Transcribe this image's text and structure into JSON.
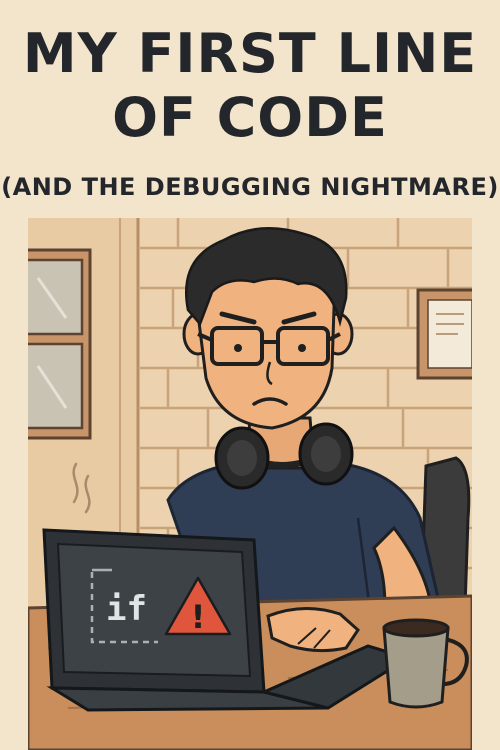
{
  "header": {
    "title_line1": "MY FIRST LINE",
    "title_line2": "OF CODE",
    "subtitle": "(AND THE DEBUGGING NIGHTMARE)"
  },
  "illustration": {
    "screen_code": "if",
    "warning_symbol": "!",
    "colors": {
      "background": "#f3e4cc",
      "wall": "#ecd2ae",
      "brick_line": "#c9a47a",
      "shirt": "#2f3d55",
      "skin": "#f0b27f",
      "hair": "#2b2b2b",
      "laptop": "#2e3236",
      "screen": "#3d4247",
      "warning": "#e0563d",
      "desk": "#c98e5b",
      "mug": "#a39d8a"
    }
  }
}
